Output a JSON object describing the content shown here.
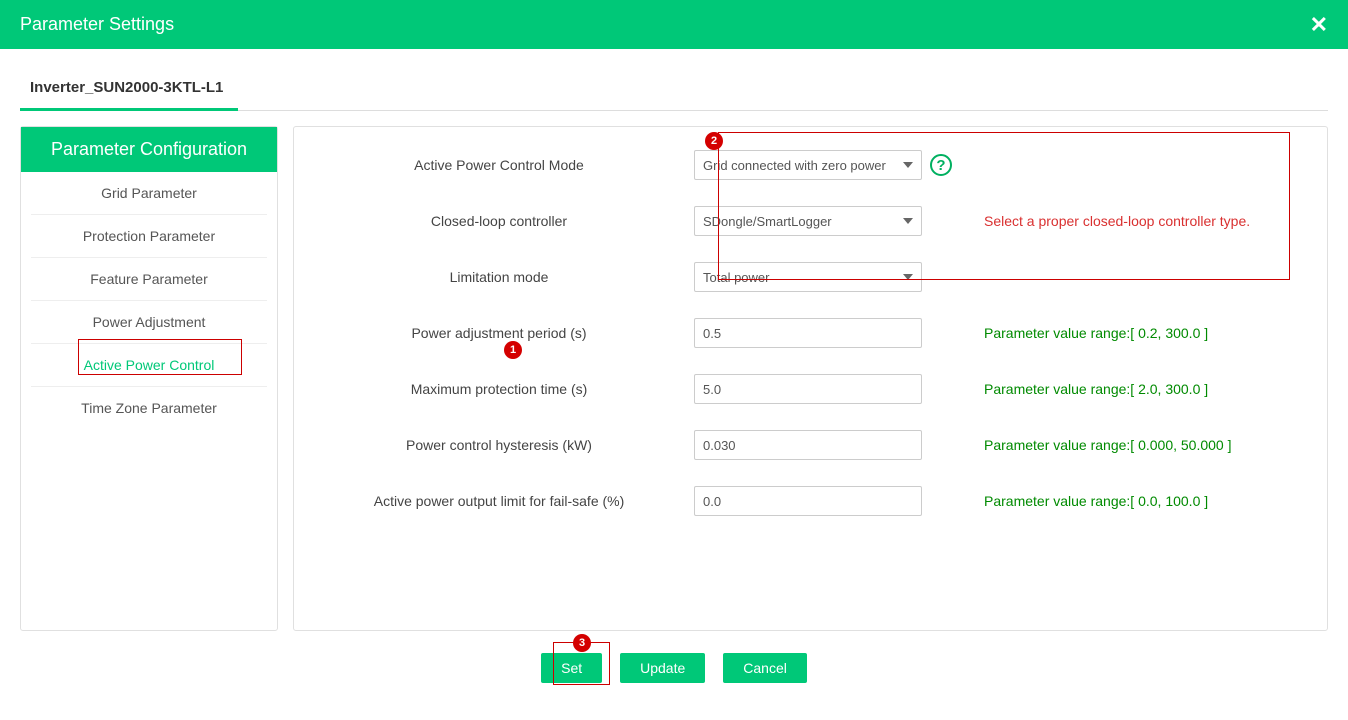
{
  "header": {
    "title": "Parameter Settings"
  },
  "tab": {
    "name": "Inverter_SUN2000-3KTL-L1"
  },
  "sidebar": {
    "header": "Parameter Configuration",
    "items": [
      "Grid Parameter",
      "Protection Parameter",
      "Feature Parameter",
      "Power Adjustment",
      "Active Power Control",
      "Time Zone Parameter"
    ]
  },
  "form": {
    "apcm_label": "Active Power Control Mode",
    "apcm_value": "Grid connected with zero power",
    "clc_label": "Closed-loop controller",
    "clc_value": "SDongle/SmartLogger",
    "clc_hint": "Select a proper closed-loop controller type.",
    "lim_label": "Limitation mode",
    "lim_value": "Total power",
    "pap_label": "Power adjustment period (s)",
    "pap_value": "0.5",
    "pap_hint": "Parameter value range:[ 0.2, 300.0 ]",
    "mpt_label": "Maximum protection time (s)",
    "mpt_value": "5.0",
    "mpt_hint": "Parameter value range:[ 2.0, 300.0 ]",
    "pch_label": "Power control hysteresis (kW)",
    "pch_value": "0.030",
    "pch_hint": "Parameter value range:[ 0.000, 50.000 ]",
    "apolfs_label": "Active power output limit for fail-safe (%)",
    "apolfs_value": "0.0",
    "apolfs_hint": "Parameter value range:[ 0.0, 100.0 ]"
  },
  "buttons": {
    "set": "Set",
    "update": "Update",
    "cancel": "Cancel"
  },
  "badges": {
    "b1": "1",
    "b2": "2",
    "b3": "3"
  }
}
